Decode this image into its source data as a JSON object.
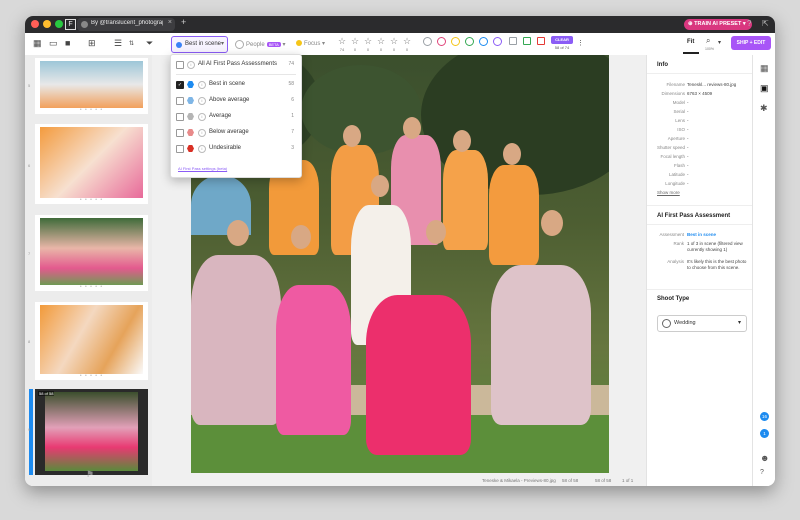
{
  "titlebar": {
    "app_logo": "F",
    "tab_title": "By @translucent_photography ...",
    "tab_close": "×",
    "new_tab": "+",
    "train_label": "TRAIN AI PRESET",
    "help_icon": "?",
    "ext_icon": "⇱"
  },
  "toolbar": {
    "filter_label": "Best in scene",
    "people_label": "People",
    "people_badge": "BETA",
    "focus_label": "Focus",
    "star_counts": [
      "74",
      "0",
      "0",
      "0",
      "0",
      "0"
    ],
    "clear_label": "CLEAR",
    "count_label": "58 of 74",
    "fit_label": "Fit",
    "zoom_label": "100%",
    "ship_label": "SHIP + EDIT",
    "colors": {
      "accent": "#8b5cf6",
      "ring_colors": [
        "#9aa0a6",
        "#e0457b",
        "#f5c518",
        "#34a853",
        "#1d8bf0",
        "#8b5cf6",
        "#9aa0a6"
      ],
      "square_colors": [
        "#9aa0a6",
        "#34a853",
        "#e53935"
      ]
    }
  },
  "dropdown": {
    "header": {
      "label": "All AI First Pass Assessments",
      "count": "74"
    },
    "items": [
      {
        "label": "Best in scene",
        "count": "58",
        "checked": true,
        "color": "#1d8bf0"
      },
      {
        "label": "Above average",
        "count": "6",
        "checked": false,
        "color": "#7fb6e6"
      },
      {
        "label": "Average",
        "count": "1",
        "checked": false,
        "color": "#b5b5b5"
      },
      {
        "label": "Below average",
        "count": "7",
        "checked": false,
        "color": "#e88a8a"
      },
      {
        "label": "Undesirable",
        "count": "3",
        "checked": false,
        "color": "#d93025"
      }
    ],
    "link": "AI First Pass settings (beta)"
  },
  "filmstrip": {
    "numbers": [
      "5",
      "6",
      "7",
      "8",
      "9"
    ],
    "selected_label": "58 of 58",
    "footer_icon": "⚑"
  },
  "status": {
    "filename": "Teneske & Mikaela - Previews-80.jpg",
    "counter_a": "58 of 58",
    "counter_b": "58 of 58",
    "page": "1 of 1"
  },
  "info": {
    "title": "Info",
    "rows": [
      {
        "k": "Filename",
        "v": "Teneskl... reviews-80.jpg"
      },
      {
        "k": "Dimensions",
        "v": "6763 × 4509"
      },
      {
        "k": "Model",
        "v": "-"
      },
      {
        "k": "Serial",
        "v": "-"
      },
      {
        "k": "Lens",
        "v": "-"
      },
      {
        "k": "ISO",
        "v": "-"
      },
      {
        "k": "Aperture",
        "v": "-"
      },
      {
        "k": "Shutter speed",
        "v": "-"
      },
      {
        "k": "Focal length",
        "v": "-"
      },
      {
        "k": "Flash",
        "v": "-"
      },
      {
        "k": "Latitude",
        "v": "-"
      },
      {
        "k": "Longitude",
        "v": "-"
      }
    ],
    "show_more": "Show more"
  },
  "assessment": {
    "title": "AI First Pass Assessment",
    "assessment_key": "Assessment",
    "assessment_val": "Best in scene",
    "rank_key": "Rank",
    "rank_val": "1 of 3 in scene (filtered view currently showing 1)",
    "analysis_key": "Analysis",
    "analysis_val": "It's likely this is the best photo to choose from this scene."
  },
  "shoot": {
    "title": "Shoot Type",
    "value": "Wedding"
  },
  "side": {
    "badge_a": "16",
    "badge_b": "1"
  }
}
